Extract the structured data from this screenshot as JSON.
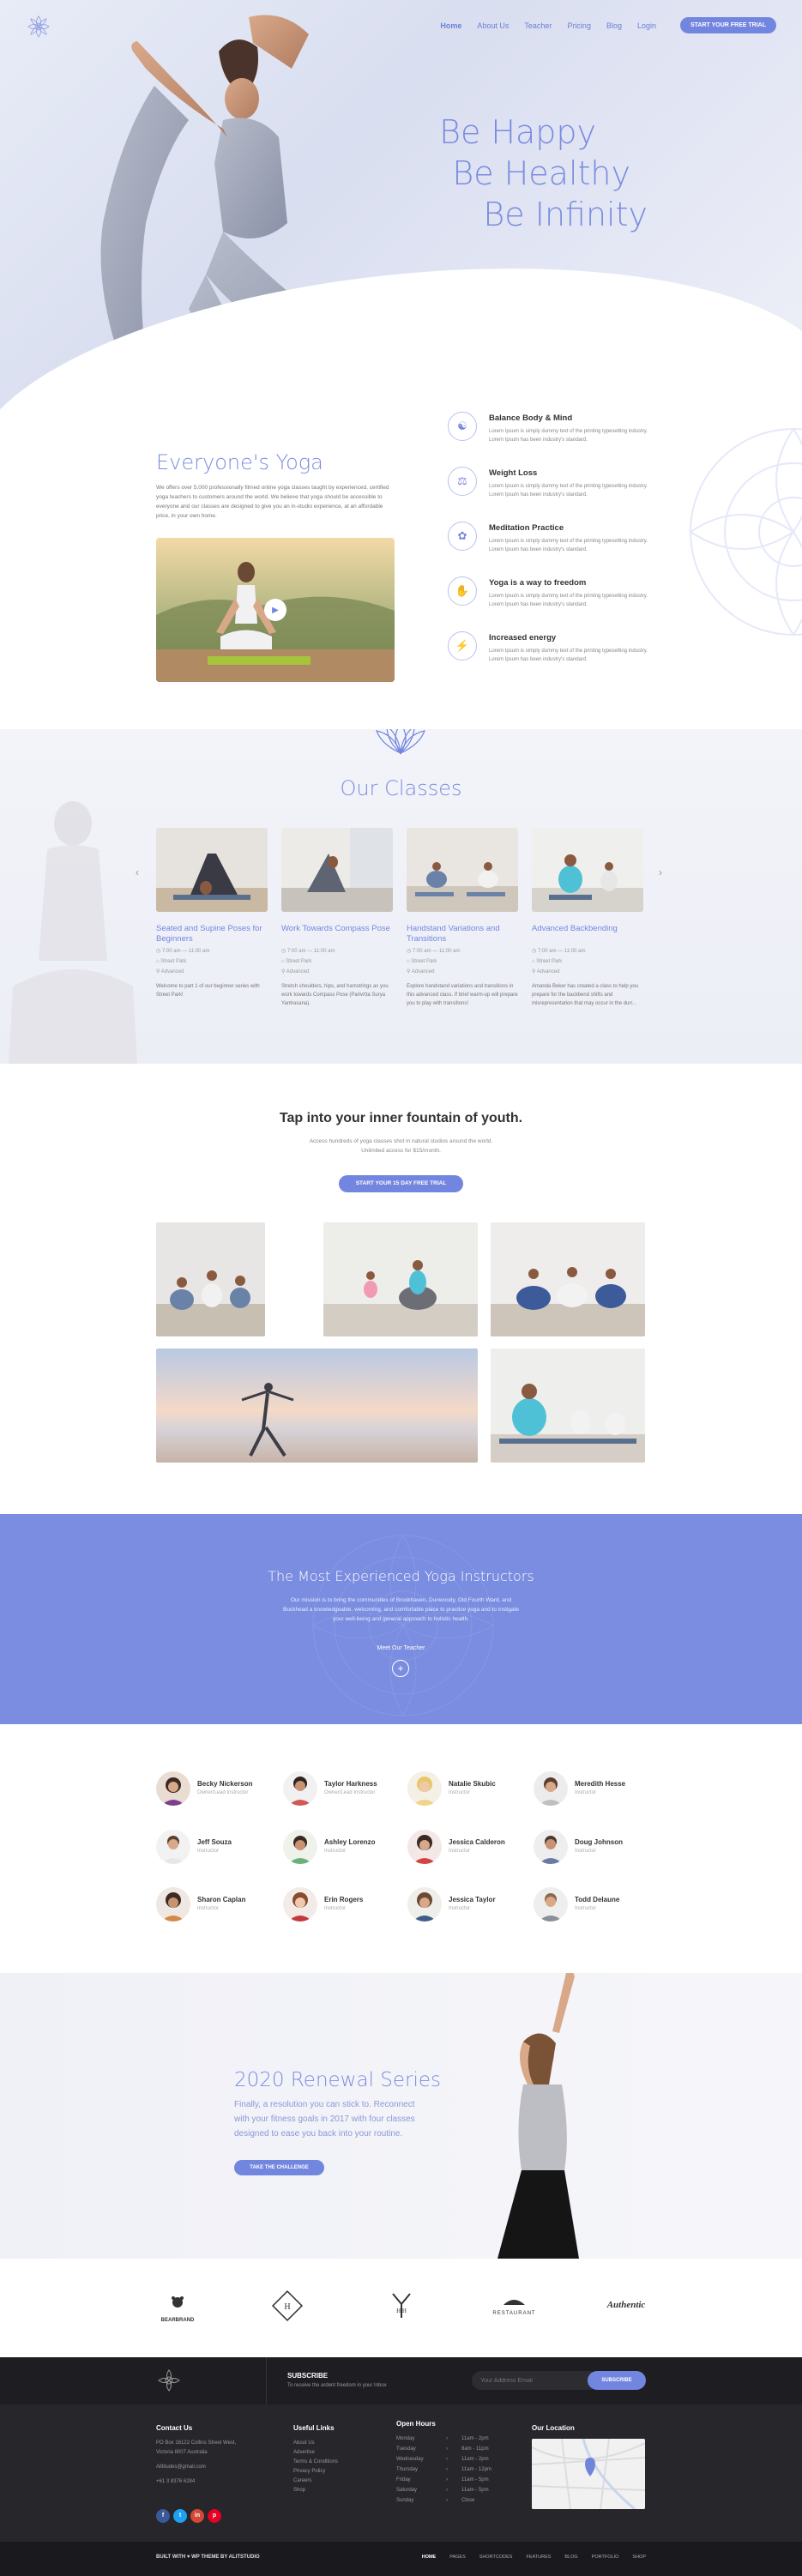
{
  "nav": {
    "links": [
      "Home",
      "About Us",
      "Teacher",
      "Pricing",
      "Blog",
      "Login"
    ],
    "cta": "START YOUR FREE TRIAL"
  },
  "hero": {
    "lines": [
      "Be Happy",
      "Be Healthy",
      "Be Infinity"
    ]
  },
  "about": {
    "title": "Everyone's Yoga",
    "desc": "We offers over 5,000 professionally filmed online yoga classes taught by experienced, certified yoga teachers to customers around the world. We believe that yoga should be accessible to everyone and our classes are designed to give you an in-studio experience, at an affordable price, in your own home.",
    "features": [
      {
        "title": "Balance Body & Mind",
        "desc": "Lorem Ipsum is simply dummy text of the printing typesetting industry. Lorem Ipsum has been industry's standard."
      },
      {
        "title": "Weight Loss",
        "desc": "Lorem Ipsum is simply dummy text of the printing typesetting industry. Lorem Ipsum has been industry's standard."
      },
      {
        "title": "Meditation Practice",
        "desc": "Lorem Ipsum is simply dummy text of the printing typesetting industry. Lorem Ipsum has been industry's standard."
      },
      {
        "title": "Yoga is a way to freedom",
        "desc": "Lorem Ipsum is simply dummy text of the printing typesetting industry. Lorem Ipsum has been industry's standard."
      },
      {
        "title": "Increased energy",
        "desc": "Lorem Ipsum is simply dummy text of the printing typesetting industry. Lorem Ipsum has been industry's standard."
      }
    ]
  },
  "classes": {
    "title": "Our Classes",
    "items": [
      {
        "name": "Seated and Supine Poses for Beginners",
        "time": "7:00 am — 11:00 am",
        "place": "Street Park",
        "level": "Advanced",
        "desc": "Welcome to part 1 of our beginner series with Street Park!"
      },
      {
        "name": "Work Towards Compass Pose",
        "time": "7:00 am — 11:00 am",
        "place": "Street Park",
        "level": "Advanced",
        "desc": "Stretch shoulders, hips, and hamstrings as you work towards Compass Pose (Parivrtta Surya Yantrasana)."
      },
      {
        "name": "Handstand Variations and Transitions",
        "time": "7:00 am — 11:00 am",
        "place": "Street Park",
        "level": "Advanced",
        "desc": "Explore handstand variations and transitions in this advanced class. If brief warm-up will prepare you to play with transitions!"
      },
      {
        "name": "Advanced Backbending",
        "time": "7:00 am — 11:00 am",
        "place": "Street Park",
        "level": "Advanced",
        "desc": "Amanda Beker has created a class to help you prepare for the backbend shifts and misrepresentation that may occur in the durr..."
      }
    ]
  },
  "tap": {
    "title": "Tap into your inner fountain of youth.",
    "sub": "Access hundreds of yoga classes shot in natural studios around the world. Unlimited access for $15/month.",
    "cta": "START YOUR 15 DAY FREE TRIAL"
  },
  "instructors": {
    "title": "The Most Experienced Yoga Instructors",
    "desc": "Our mission is to bring the communities of Brookhaven, Dunwoody, Old Fourth Ward, and Buckhead a knowledgeable, welcoming, and comfortable place to practice yoga and to instigate your well-being and general approach to holistic health.",
    "link": "Meet Our Teacher"
  },
  "team": [
    {
      "name": "Becky Nickerson",
      "role": "Owner/Lead Instructor"
    },
    {
      "name": "Taylor Harkness",
      "role": "Owner/Lead Instructor"
    },
    {
      "name": "Natalie Skubic",
      "role": "Instructor"
    },
    {
      "name": "Meredith Hesse",
      "role": "Instructor"
    },
    {
      "name": "Jeff Souza",
      "role": "Instructor"
    },
    {
      "name": "Ashley Lorenzo",
      "role": "Instructor"
    },
    {
      "name": "Jessica Calderon",
      "role": "Instructor"
    },
    {
      "name": "Doug Johnson",
      "role": "Instructor"
    },
    {
      "name": "Sharon Caplan",
      "role": "Instructor"
    },
    {
      "name": "Erin Rogers",
      "role": "Instructor"
    },
    {
      "name": "Jessica Taylor",
      "role": "Instructor"
    },
    {
      "name": "Todd Delaune",
      "role": "Instructor"
    }
  ],
  "renewal": {
    "title": "2020 Renewal Series",
    "desc": "Finally, a resolution you can stick to. Reconnect with your fitness goals in 2017 with four classes designed to ease you back into your routine.",
    "cta": "TAKE THE CHALLENGE"
  },
  "brands": [
    "BEARBRAND",
    "H",
    "H H",
    "RESTAURANT",
    "Authentic"
  ],
  "footer": {
    "subscribe_title": "SUBSCRIBE",
    "subscribe_text": "To receive the ardent freedom in your Inbox",
    "email_placeholder": "Your Address Email",
    "subscribe_btn": "SUBSCRIBE",
    "contact_title": "Contact Us",
    "contact_lines": [
      "PO Box 16122 Collins Street West,",
      "Victoria 8007 Australia",
      "Alltitudes@gmail.com",
      "+61 3 8376 6284"
    ],
    "links_title": "Useful Links",
    "links": [
      "About Us",
      "Advertise",
      "Terms & Conditions",
      "Privacy Policy",
      "Careers",
      "Shop"
    ],
    "hours_title": "Open Hours",
    "hours": [
      {
        "day": "Monday",
        "time": "11am - 2pm"
      },
      {
        "day": "Tuesday",
        "time": "8am - 11pm"
      },
      {
        "day": "Wednesday",
        "time": "11am - 2pm"
      },
      {
        "day": "Thursday",
        "time": "11am - 12pm"
      },
      {
        "day": "Friday",
        "time": "11am - 5pm"
      },
      {
        "day": "Saturday",
        "time": "11am - 5pm"
      },
      {
        "day": "Sunday",
        "time": "Close"
      }
    ],
    "location_title": "Our Location",
    "social": [
      "f",
      "t",
      "in",
      "p"
    ],
    "copyright": "BUILT WITH ♥ WP THEME BY ALITSTUDIO",
    "bottom_links": [
      "HOME",
      "PAGES",
      "SHORTCODES",
      "FEATURES",
      "BLOG",
      "PORTFOLIO",
      "SHOP"
    ]
  },
  "colors": {
    "accent": "#7286e0",
    "footer_bg": "#26262b"
  }
}
